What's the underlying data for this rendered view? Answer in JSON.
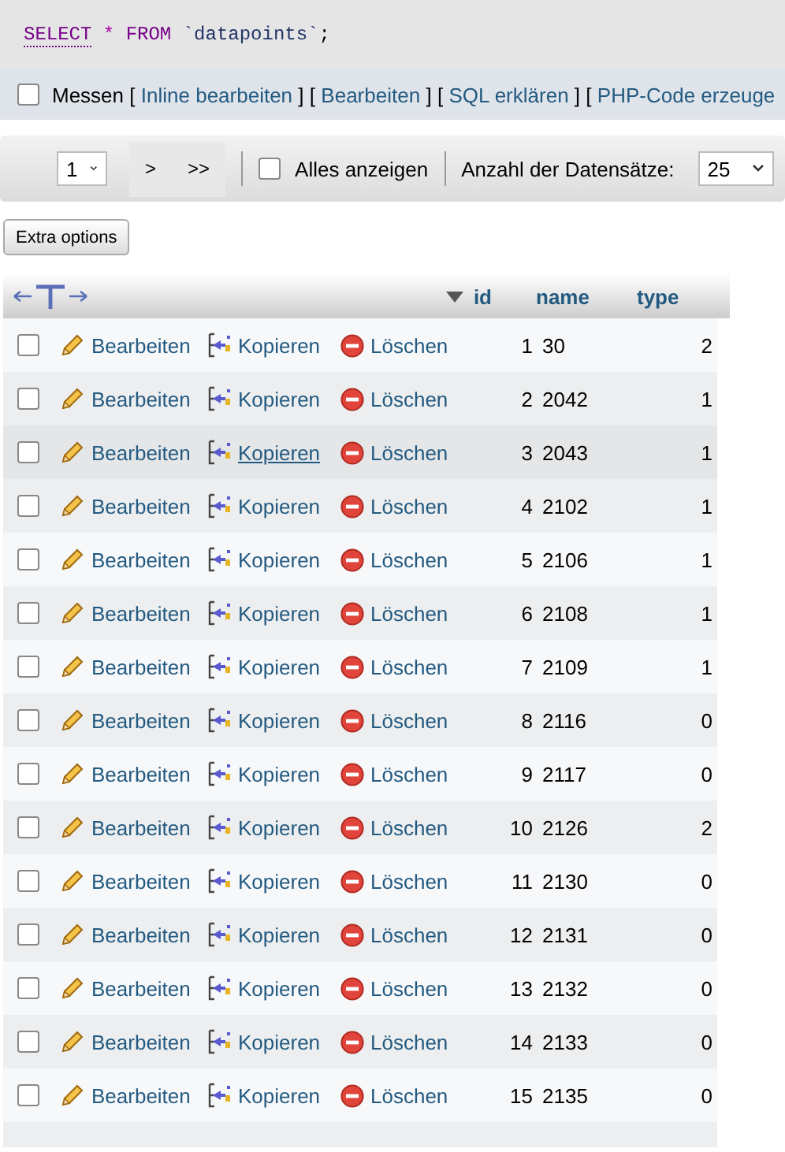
{
  "sql": {
    "keyword": "SELECT",
    "star": "*",
    "from": "FROM",
    "table": "`datapoints`",
    "end": ";"
  },
  "query_actions": {
    "checkbox": {
      "label": "Messen",
      "checked": false
    },
    "links": [
      {
        "open": "[",
        "label": "Inline bearbeiten",
        "close": "]"
      },
      {
        "open": "[",
        "label": "Bearbeiten",
        "close": "]"
      },
      {
        "open": "[",
        "label": "SQL erklären",
        "close": "]"
      },
      {
        "open": "[",
        "label": "PHP-Code erzeuge"
      }
    ]
  },
  "navigation": {
    "page": "1",
    "next": ">",
    "last": ">>",
    "show_all": {
      "label": "Alles anzeigen",
      "checked": false
    },
    "rows_label": "Anzahl der Datensätze:",
    "rows_value": "25"
  },
  "extra_options": "Extra options",
  "table": {
    "columns": [
      {
        "label": "id",
        "sorted": true
      },
      {
        "label": "name",
        "sorted": false
      },
      {
        "label": "type",
        "sorted": false
      }
    ],
    "rows": [
      {
        "actions": [
          "Bearbeiten",
          "Kopieren",
          "Löschen"
        ],
        "id": "1",
        "name": "30",
        "type": "2",
        "checked": false,
        "hovered": false
      },
      {
        "actions": [
          "Bearbeiten",
          "Kopieren",
          "Löschen"
        ],
        "id": "2",
        "name": "2042",
        "type": "1",
        "checked": false,
        "hovered": false
      },
      {
        "actions": [
          "Bearbeiten",
          "Kopieren",
          "Löschen"
        ],
        "id": "3",
        "name": "2043",
        "type": "1",
        "checked": false,
        "hovered": true
      },
      {
        "actions": [
          "Bearbeiten",
          "Kopieren",
          "Löschen"
        ],
        "id": "4",
        "name": "2102",
        "type": "1",
        "checked": false,
        "hovered": false
      },
      {
        "actions": [
          "Bearbeiten",
          "Kopieren",
          "Löschen"
        ],
        "id": "5",
        "name": "2106",
        "type": "1",
        "checked": false,
        "hovered": false
      },
      {
        "actions": [
          "Bearbeiten",
          "Kopieren",
          "Löschen"
        ],
        "id": "6",
        "name": "2108",
        "type": "1",
        "checked": false,
        "hovered": false
      },
      {
        "actions": [
          "Bearbeiten",
          "Kopieren",
          "Löschen"
        ],
        "id": "7",
        "name": "2109",
        "type": "1",
        "checked": false,
        "hovered": false
      },
      {
        "actions": [
          "Bearbeiten",
          "Kopieren",
          "Löschen"
        ],
        "id": "8",
        "name": "2116",
        "type": "0",
        "checked": false,
        "hovered": false
      },
      {
        "actions": [
          "Bearbeiten",
          "Kopieren",
          "Löschen"
        ],
        "id": "9",
        "name": "2117",
        "type": "0",
        "checked": false,
        "hovered": false
      },
      {
        "actions": [
          "Bearbeiten",
          "Kopieren",
          "Löschen"
        ],
        "id": "10",
        "name": "2126",
        "type": "2",
        "checked": false,
        "hovered": false
      },
      {
        "actions": [
          "Bearbeiten",
          "Kopieren",
          "Löschen"
        ],
        "id": "11",
        "name": "2130",
        "type": "0",
        "checked": false,
        "hovered": false
      },
      {
        "actions": [
          "Bearbeiten",
          "Kopieren",
          "Löschen"
        ],
        "id": "12",
        "name": "2131",
        "type": "0",
        "checked": false,
        "hovered": false
      },
      {
        "actions": [
          "Bearbeiten",
          "Kopieren",
          "Löschen"
        ],
        "id": "13",
        "name": "2132",
        "type": "0",
        "checked": false,
        "hovered": false
      },
      {
        "actions": [
          "Bearbeiten",
          "Kopieren",
          "Löschen"
        ],
        "id": "14",
        "name": "2133",
        "type": "0",
        "checked": false,
        "hovered": false
      },
      {
        "actions": [
          "Bearbeiten",
          "Kopieren",
          "Löschen"
        ],
        "id": "15",
        "name": "2135",
        "type": "0",
        "checked": false,
        "hovered": false
      }
    ]
  }
}
